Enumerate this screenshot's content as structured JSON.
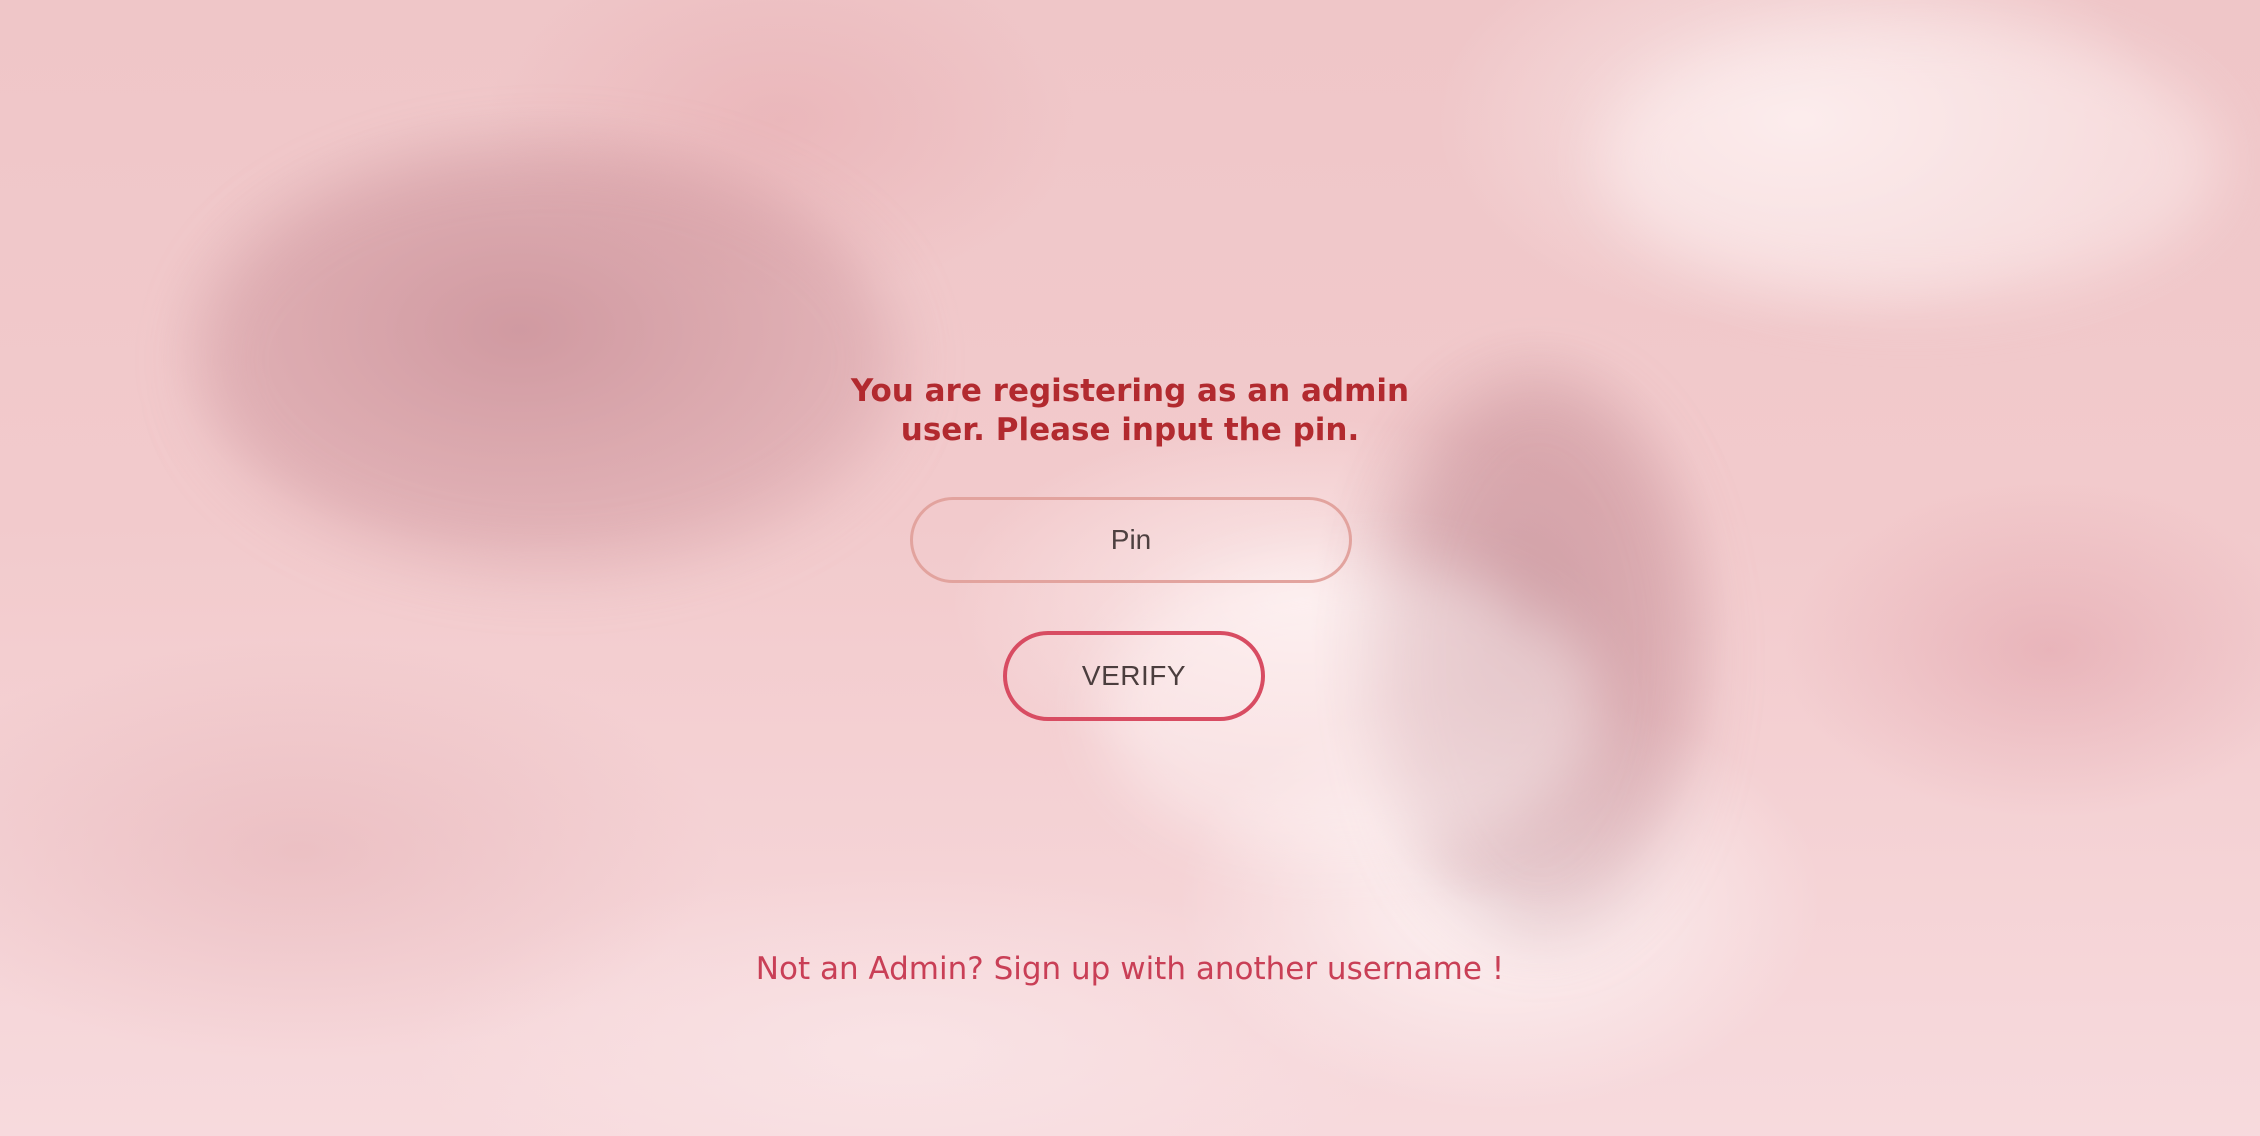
{
  "heading": {
    "line1": "You are registering as an admin",
    "line2": "user. Please input the pin."
  },
  "pin_input": {
    "placeholder": "Pin",
    "value": ""
  },
  "verify_button": {
    "label": "VERIFY"
  },
  "signup_link": {
    "label": "Not an Admin? Sign up with another username !"
  },
  "colors": {
    "heading": "#b22a2f",
    "input_border": "#e2a39e",
    "button_border": "#d84c62",
    "link": "#c93f56"
  }
}
